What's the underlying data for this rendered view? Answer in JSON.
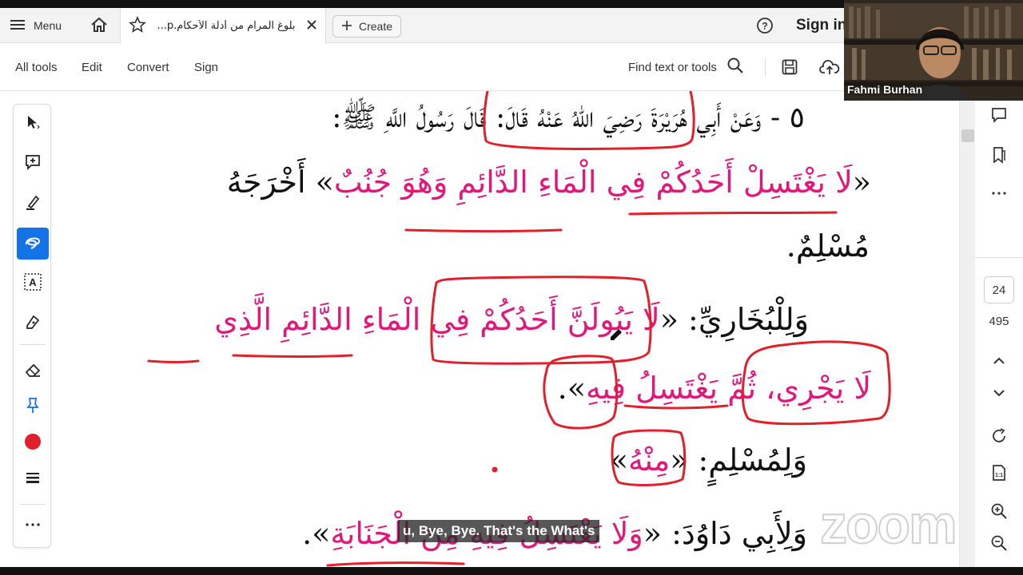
{
  "tabbar": {
    "menu_label": "Menu",
    "doc_tab_title": "بلوغ المرام من أدلة الأحكام.p...",
    "create_label": "Create",
    "signin_label": "Sign in"
  },
  "toolbar": {
    "all_tools": "All tools",
    "edit": "Edit",
    "convert": "Convert",
    "sign": "Sign",
    "find_text": "Find text or tools"
  },
  "pagination": {
    "current_page": "24",
    "total_pages": "495"
  },
  "document": {
    "line1": "٥ - وَعَنْ أَبِي هُرَيْرَةَ رَضِيَ اللهُ عَنْهُ قَالَ: قَالَ رَسُولُ اللَّهِ ﷺ:",
    "line2_open": "«",
    "line2_pink": "لَا يَغْتَسِلْ أَحَدُكُمْ فِي الْمَاءِ الدَّائِمِ وَهُوَ جُنُبٌ",
    "line2_rest": "» أَخْرَجَهُ",
    "line3": "مُسْلِمٌ.",
    "line4_black": "وَلِلْبُخَارِيِّ: «",
    "line4_pink": "لَا يَبُولَنَّ أَحَدُكُمْ فِي الْمَاءِ الدَّائِمِ الَّذِي",
    "line5_pink": "لَا يَجْرِي، ثُمَّ يَغْتَسِلُ فِيهِ",
    "line5_end": "».",
    "line6_black": "وَلِمُسْلِمٍ: «",
    "line6_pink": "مِنْهُ",
    "line6_end": "»",
    "line7_black": "وَلِأَبِي دَاوُدَ: «",
    "line7_pink": "وَلَا يَغْتَسِلُ فِيهِ مِنَ الْجَنَابَةِ",
    "line7_end": "»."
  },
  "webcam": {
    "name": "Fahmi Burhan"
  },
  "caption": {
    "text": "u, Bye, Bye. That's the What's"
  },
  "watermark": {
    "text": "zoom"
  },
  "colors": {
    "accent": "#1473e6",
    "arabic_pink": "#e0187a",
    "annotation_red": "#e0202a"
  }
}
